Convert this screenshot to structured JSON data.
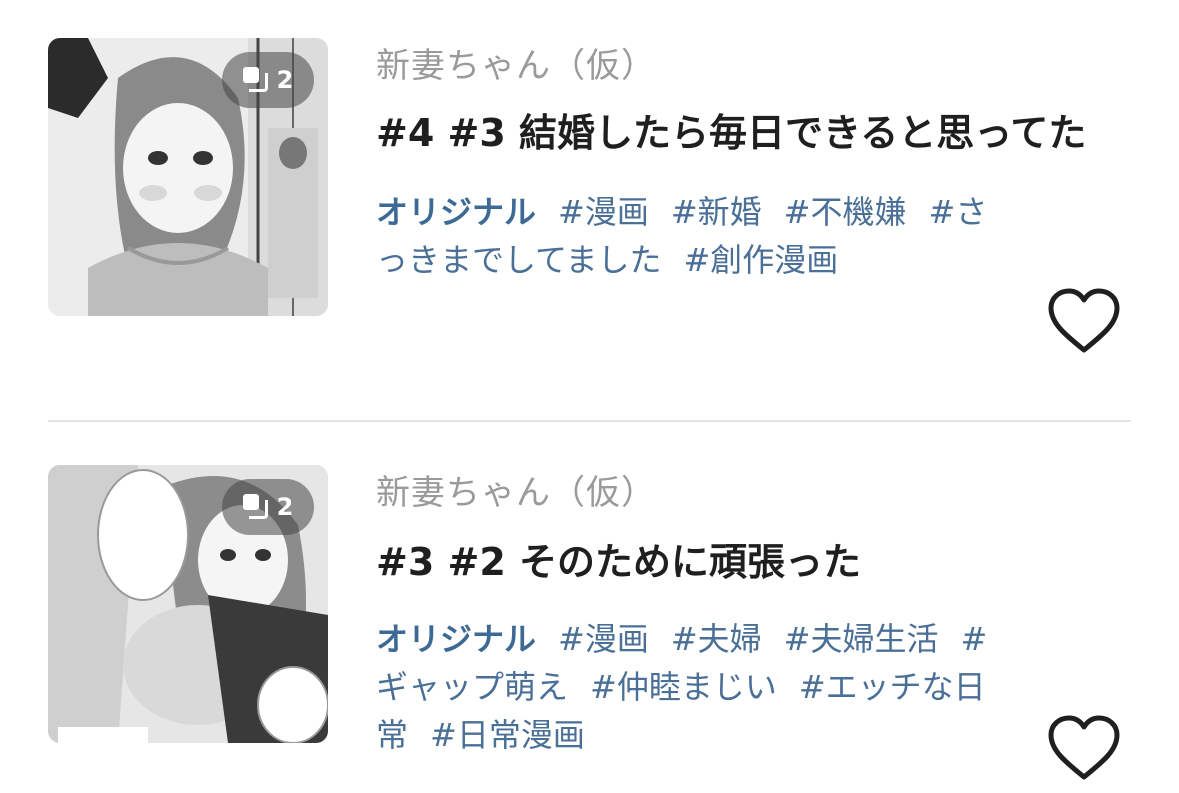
{
  "posts": [
    {
      "author": "新妻ちゃん（仮）",
      "title": "#4 #3 結婚したら毎日できると思ってた",
      "page_count": "2",
      "original_label": "オリジナル",
      "tags": [
        "#漫画",
        "#新婚",
        "#不機嫌",
        "#さっきまでしてました",
        "#創作漫画"
      ]
    },
    {
      "author": "新妻ちゃん（仮）",
      "title": "#3 #2 そのために頑張った",
      "page_count": "2",
      "original_label": "オリジナル",
      "tags": [
        "#漫画",
        "#夫婦",
        "#夫婦生活",
        "#ギャップ萌え",
        "#仲睦まじい",
        "#エッチな日常",
        "#日常漫画"
      ]
    }
  ],
  "icons": {
    "page_count": "pages-icon",
    "like": "heart-outline-icon"
  },
  "colors": {
    "tag": "#3d6a94",
    "author": "#9a9a9a",
    "title": "#1f1f1f",
    "divider": "#e3e3e3"
  }
}
